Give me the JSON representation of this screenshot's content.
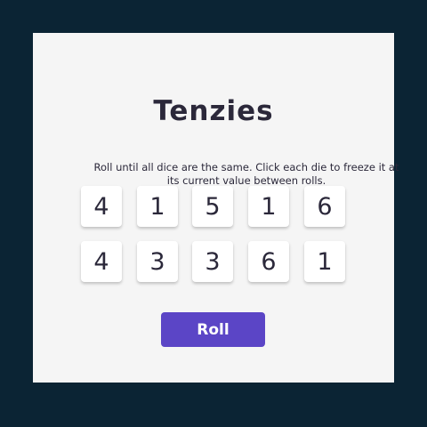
{
  "app": {
    "title": "Tenzies",
    "instructions": "Roll until all dice are the same. Click each die to freeze it at its current value between rolls."
  },
  "dice": [
    {
      "value": "4",
      "held": false
    },
    {
      "value": "1",
      "held": false
    },
    {
      "value": "5",
      "held": false
    },
    {
      "value": "1",
      "held": false
    },
    {
      "value": "6",
      "held": false
    },
    {
      "value": "4",
      "held": false
    },
    {
      "value": "3",
      "held": false
    },
    {
      "value": "3",
      "held": false
    },
    {
      "value": "6",
      "held": false
    },
    {
      "value": "1",
      "held": false
    }
  ],
  "controls": {
    "roll_label": "Roll"
  },
  "colors": {
    "background": "#0b2434",
    "card": "#f5f5f5",
    "button": "#5b45c6",
    "text": "#2b283a"
  }
}
